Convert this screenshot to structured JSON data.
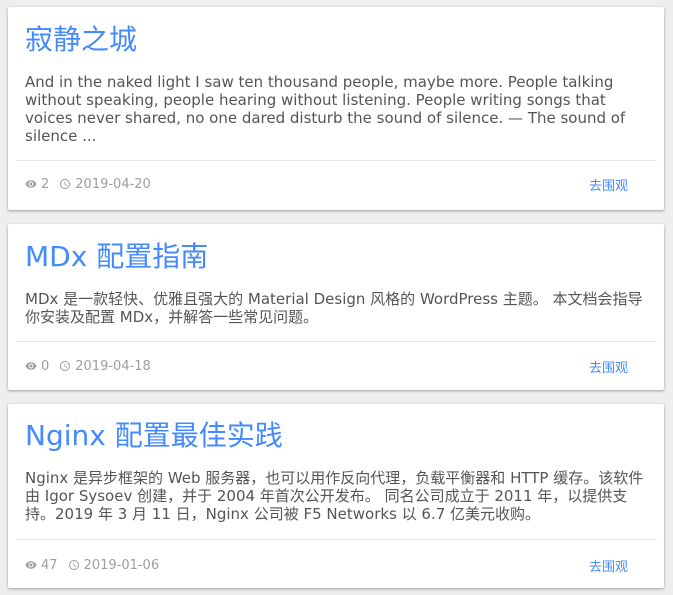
{
  "cards": [
    {
      "title": "寂静之城",
      "excerpt": "And in the naked light I saw ten thousand people, maybe more. People talking without speaking, people hearing without listening. People writing songs that voices never shared, no one dared disturb the sound of silence. — The sound of silence ...",
      "views": "2",
      "date": "2019-04-20",
      "link_label": "去围观"
    },
    {
      "title": "MDx 配置指南",
      "excerpt": "MDx 是一款轻快、优雅且强大的 Material Design 风格的 WordPress 主题。 本文档会指导你安装及配置 MDx，并解答一些常见问题。",
      "views": "0",
      "date": "2019-04-18",
      "link_label": "去围观"
    },
    {
      "title": "Nginx 配置最佳实践",
      "excerpt": "Nginx 是异步框架的 Web 服务器，也可以用作反向代理，负载平衡器和 HTTP 缓存。该软件由 Igor Sysoev 创建，并于 2004 年首次公开发布。 同名公司成立于 2011 年，以提供支持。2019 年 3 月 11 日，Nginx 公司被 F5 Networks 以 6.7 亿美元收购。",
      "views": "47",
      "date": "2019-01-06",
      "link_label": "去围观"
    }
  ]
}
